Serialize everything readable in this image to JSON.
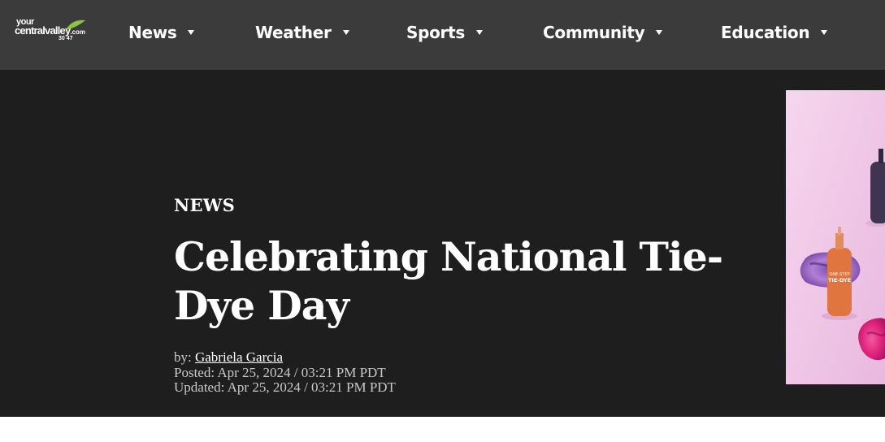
{
  "site": {
    "logo_line1": "your",
    "logo_line2": "centralvalley",
    "logo_domain": ".com",
    "logo_channels": "30 47"
  },
  "nav": {
    "items": [
      {
        "label": "News"
      },
      {
        "label": "Weather"
      },
      {
        "label": "Sports"
      },
      {
        "label": "Community"
      },
      {
        "label": "Education"
      }
    ]
  },
  "article": {
    "section": "NEWS",
    "title": "Celebrating National Tie-Dye Day",
    "byline_prefix": "by:",
    "author": "Gabriela Garcia",
    "posted": "Posted: Apr 25, 2024 / 03:21 PM PDT",
    "updated": "Updated: Apr 25, 2024 / 03:21 PM PDT"
  },
  "photo": {
    "bottle_label_top": "ONE-STEP",
    "bottle_label_main": "TIE-DYE"
  },
  "colors": {
    "nav_bg": "#3b3b3b",
    "hero_bg": "#1e1e1e",
    "logo_leaf": "#8cc63f",
    "photo_bg": "#f1c9e8"
  }
}
